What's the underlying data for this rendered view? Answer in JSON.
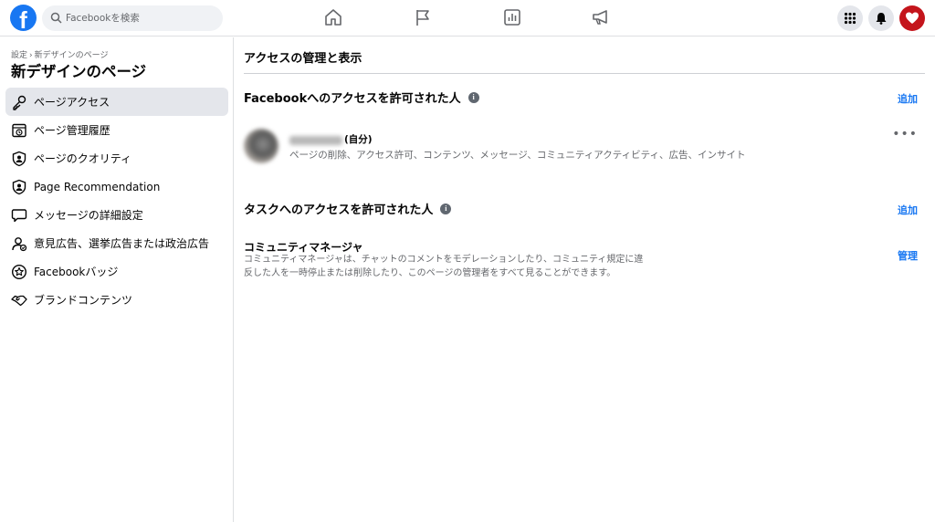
{
  "topbar": {
    "logo_letter": "f",
    "search_placeholder": "Facebookを検索",
    "nav": [
      "home-icon",
      "pages-flag-icon",
      "insights-chart-icon",
      "ads-megaphone-icon"
    ],
    "right": [
      "menu-grid-icon",
      "notifications-bell-icon",
      "profile-avatar"
    ],
    "brand_color": "#1877f2"
  },
  "sidebar": {
    "breadcrumb": [
      "設定",
      "新デザインのページ"
    ],
    "breadcrumb_sep": "›",
    "title": "新デザインのページ",
    "items": [
      {
        "label": "ページアクセス",
        "icon": "key-icon",
        "active": true
      },
      {
        "label": "ページ管理履歴",
        "icon": "history-icon",
        "active": false
      },
      {
        "label": "ページのクオリティ",
        "icon": "quality-shield-icon",
        "active": false
      },
      {
        "label": "Page Recommendation",
        "icon": "recommendation-shield-icon",
        "active": false
      },
      {
        "label": "メッセージの詳細設定",
        "icon": "message-bubble-icon",
        "active": false
      },
      {
        "label": "意見広告、選挙広告または政治広告",
        "icon": "political-ads-icon",
        "active": false
      },
      {
        "label": "Facebookバッジ",
        "icon": "badge-star-icon",
        "active": false
      },
      {
        "label": "ブランドコンテンツ",
        "icon": "handshake-icon",
        "active": false
      }
    ]
  },
  "main": {
    "title": "アクセスの管理と表示",
    "fb_access": {
      "heading": "Facebookへのアクセスを許可された人",
      "add_label": "追加",
      "person": {
        "self_label": "(自分)",
        "permissions": "ページの削除、アクセス許可、コンテンツ、メッセージ、コミュニティアクティビティ、広告、インサイト",
        "more_label": "•••"
      }
    },
    "task_access": {
      "heading": "タスクへのアクセスを許可された人",
      "add_label": "追加",
      "role": {
        "title": "コミュニティマネージャ",
        "description": "コミュニティマネージャは、チャットのコメントをモデレーションしたり、コミュニティ規定に違反した人を一時停止または削除したり、このページの管理者をすべて見ることができます。",
        "manage_label": "管理"
      }
    },
    "info_glyph": "i"
  }
}
